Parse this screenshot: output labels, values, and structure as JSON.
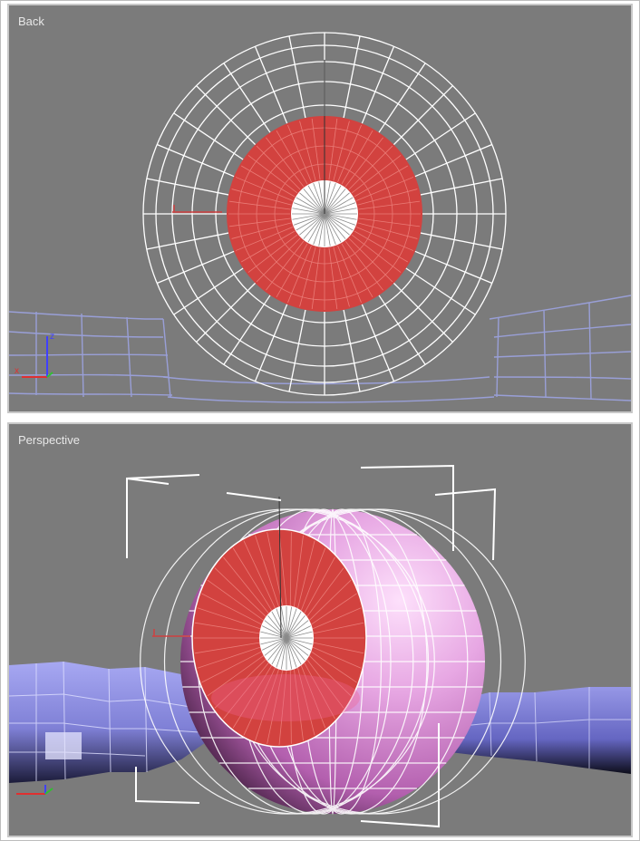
{
  "viewports": {
    "back": {
      "label": "Back"
    },
    "perspective": {
      "label": "Perspective"
    }
  },
  "colors": {
    "viewport_bg": "#7b7b7b",
    "wireframe": "#ffffff",
    "iris": "#d2423f",
    "sclera": "#d99ad6",
    "body_mesh": "#9a9ae6",
    "axis_x": "#e03030",
    "axis_y": "#30c030",
    "axis_z": "#4040ff"
  },
  "icons": {
    "axis_gizmo": "axis-tripod-icon"
  }
}
